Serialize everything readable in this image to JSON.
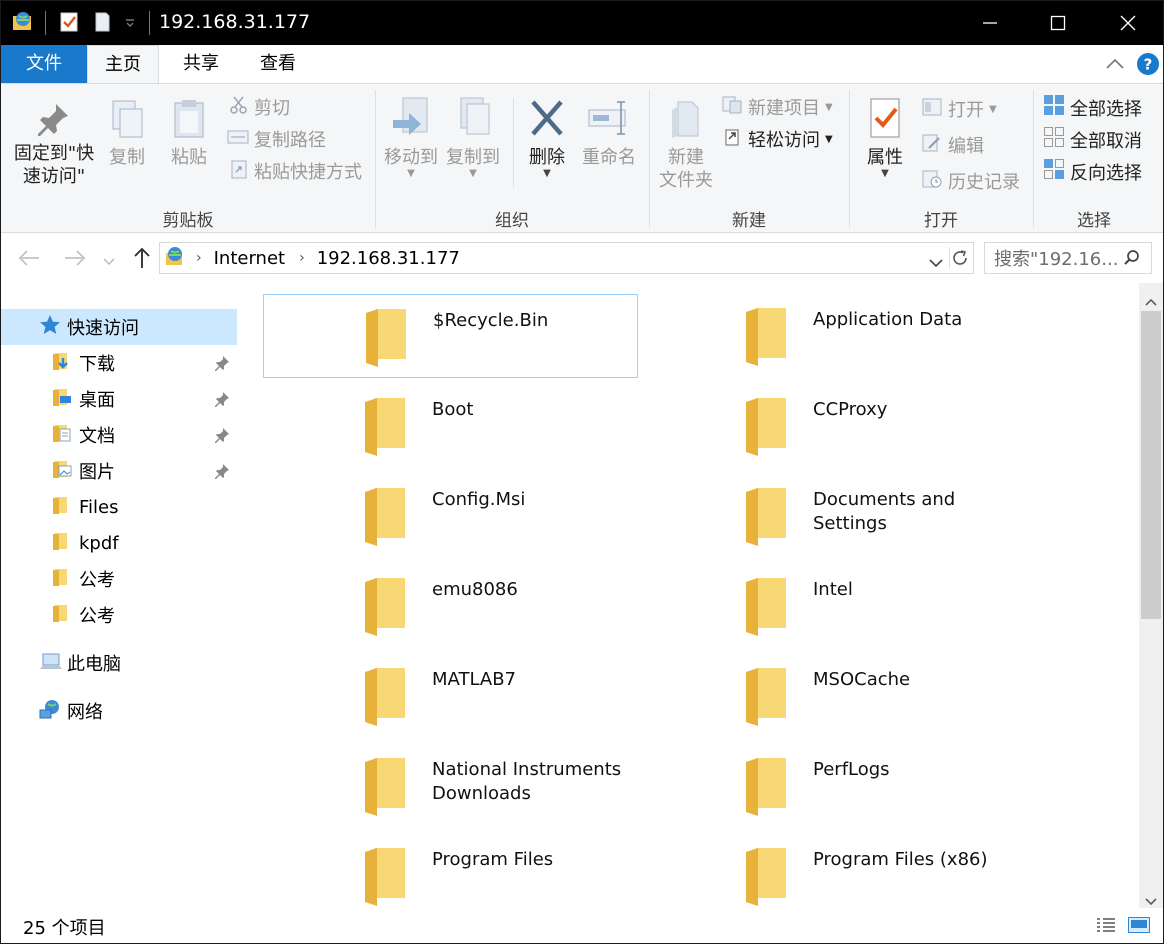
{
  "window": {
    "title": "192.168.31.177"
  },
  "tabs": [
    {
      "label": "文件"
    },
    {
      "label": "主页"
    },
    {
      "label": "共享"
    },
    {
      "label": "查看"
    }
  ],
  "ribbon": {
    "clipboard": {
      "pin_line1": "固定到\"快",
      "pin_line2": "速访问\"",
      "copy": "复制",
      "paste": "粘贴",
      "cut": "剪切",
      "copy_path": "复制路径",
      "paste_shortcut": "粘贴快捷方式",
      "label": "剪贴板"
    },
    "organize": {
      "move_to": "移动到",
      "copy_to": "复制到",
      "delete": "删除",
      "rename": "重命名",
      "label": "组织"
    },
    "new": {
      "new_folder_line1": "新建",
      "new_folder_line2": "文件夹",
      "new_item": "新建项目",
      "easy_access": "轻松访问",
      "label": "新建"
    },
    "open": {
      "properties": "属性",
      "open": "打开",
      "edit": "编辑",
      "history": "历史记录",
      "label": "打开"
    },
    "select": {
      "select_all": "全部选择",
      "select_none": "全部取消",
      "invert": "反向选择",
      "label": "选择"
    }
  },
  "address": {
    "segments": [
      "Internet",
      "192.168.31.177"
    ],
    "search_placeholder": "搜索\"192.16..."
  },
  "nav": {
    "quick_access": "快速访问",
    "items": [
      {
        "label": "下载",
        "pinned": true
      },
      {
        "label": "桌面",
        "pinned": true
      },
      {
        "label": "文档",
        "pinned": true
      },
      {
        "label": "图片",
        "pinned": true
      },
      {
        "label": "Files",
        "pinned": false
      },
      {
        "label": "kpdf",
        "pinned": false
      },
      {
        "label": "公考",
        "pinned": false
      },
      {
        "label": "公考",
        "pinned": false
      }
    ],
    "this_pc": "此电脑",
    "network": "网络"
  },
  "files": [
    {
      "name": "$Recycle.Bin",
      "selected": true
    },
    {
      "name": "Application Data"
    },
    {
      "name": "Boot"
    },
    {
      "name": "CCProxy"
    },
    {
      "name": "Config.Msi"
    },
    {
      "name": "Documents and Settings"
    },
    {
      "name": "emu8086"
    },
    {
      "name": "Intel"
    },
    {
      "name": "MATLAB7"
    },
    {
      "name": "MSOCache"
    },
    {
      "name": "National Instruments Downloads"
    },
    {
      "name": "PerfLogs"
    },
    {
      "name": "Program Files"
    },
    {
      "name": "Program Files (x86)"
    }
  ],
  "status": {
    "count": "25 个项目"
  },
  "colors": {
    "accent": "#1979ca",
    "selection": "#cce8ff",
    "folder": "#f8d775"
  }
}
